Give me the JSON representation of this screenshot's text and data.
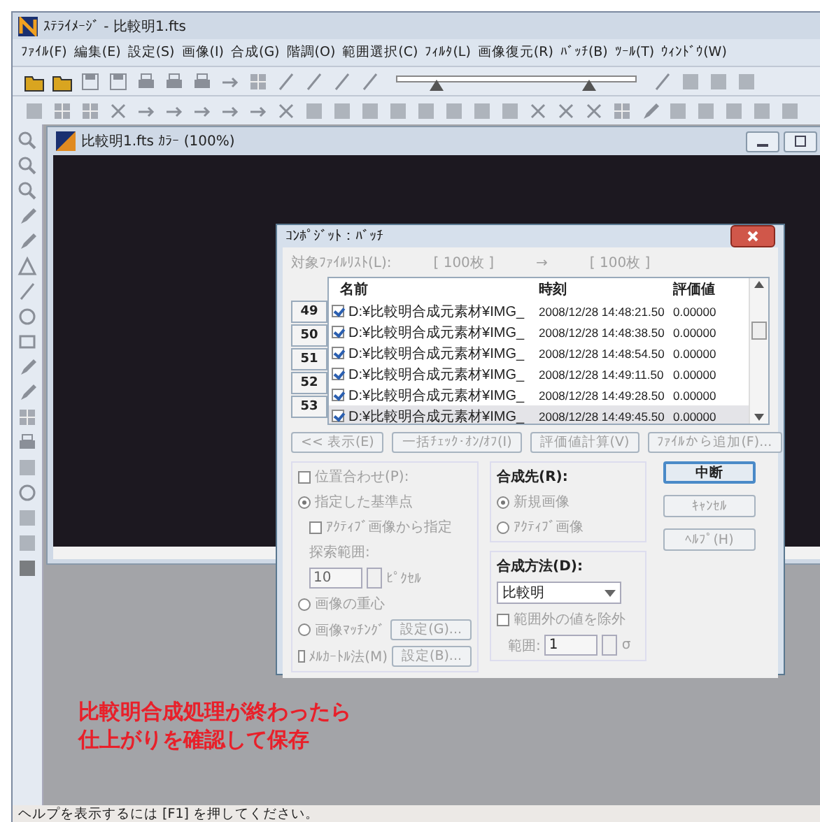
{
  "window": {
    "title": "ｽﾃﾗｲﾒｰｼﾞ - 比較明1.fts"
  },
  "menu": [
    "ﾌｧｲﾙ(F)",
    "編集(E)",
    "設定(S)",
    "画像(I)",
    "合成(G)",
    "階調(O)",
    "範囲選択(C)",
    "ﾌｨﾙﾀ(L)",
    "画像復元(R)",
    "ﾊﾞｯﾁ(B)",
    "ﾂｰﾙ(T)",
    "ｳｨﾝﾄﾞｳ(W)"
  ],
  "toolbar": {
    "slider_thumbs": [
      {
        "level": 0.17
      },
      {
        "level": 0.8
      }
    ]
  },
  "child_window": {
    "title": "比較明1.fts ｶﾗｰ (100%)"
  },
  "dialog": {
    "title": "ｺﾝﾎﾟｼﾞｯﾄ：ﾊﾞｯﾁ",
    "file_list_label": "対象ﾌｧｲﾙﾘｽﾄ(L):",
    "count_from": "[ 100枚 ]",
    "arrow": "→",
    "count_to": "[ 100枚 ]",
    "columns": [
      "名前",
      "時刻",
      "評価値"
    ],
    "rows": [
      {
        "number": "49",
        "checked": true,
        "selected": false,
        "name": "D:¥比較明合成元素材¥IMG_",
        "time": "2008/12/28 14:48:21.50",
        "value": "0.00000"
      },
      {
        "number": "50",
        "checked": true,
        "selected": false,
        "name": "D:¥比較明合成元素材¥IMG_",
        "time": "2008/12/28 14:48:38.50",
        "value": "0.00000"
      },
      {
        "number": "51",
        "checked": true,
        "selected": false,
        "name": "D:¥比較明合成元素材¥IMG_",
        "time": "2008/12/28 14:48:54.50",
        "value": "0.00000"
      },
      {
        "number": "52",
        "checked": true,
        "selected": false,
        "name": "D:¥比較明合成元素材¥IMG_",
        "time": "2008/12/28 14:49:11.50",
        "value": "0.00000"
      },
      {
        "number": "53",
        "checked": true,
        "selected": false,
        "name": "D:¥比較明合成元素材¥IMG_",
        "time": "2008/12/28 14:49:28.50",
        "value": "0.00000"
      },
      {
        "checked": true,
        "selected": true,
        "name": "D:¥比較明合成元素材¥IMG_",
        "time": "2008/12/28 14:49:45.50",
        "value": "0.00000"
      }
    ],
    "list_buttons": [
      {
        "label": "<< 表示(E)",
        "disabled": true
      },
      {
        "label": "一括ﾁｪｯｸ･ｵﾝ/ｵﾌ(I)",
        "disabled": true
      },
      {
        "label": "評価値計算(V)",
        "disabled": true
      },
      {
        "label": "ﾌｧｲﾙから追加(F)...",
        "disabled": true
      }
    ],
    "alignment": {
      "label": "位置合わせ(P):",
      "checked": false,
      "disabled": true,
      "options": [
        {
          "kind": "radio",
          "label": "指定した基準点",
          "selected": true,
          "disabled": true,
          "children": [
            {
              "kind": "checkbox",
              "label": "ｱｸﾃｨﾌﾞ画像から指定",
              "checked": false,
              "disabled": true
            },
            {
              "kind": "label",
              "label": "探索範囲:",
              "disabled": true
            },
            {
              "kind": "spin",
              "value": "10",
              "unit": "ﾋﾟｸｾﾙ",
              "disabled": true
            }
          ]
        },
        {
          "kind": "radio",
          "label": "画像の重心",
          "selected": false,
          "disabled": true
        },
        {
          "kind": "radio",
          "label": "画像ﾏｯﾁﾝｸﾞ",
          "selected": false,
          "disabled": true,
          "button": "設定(G)..."
        },
        {
          "kind": "checkbox",
          "label": "ﾒﾙｶｰﾄﾙ法(M)",
          "checked": false,
          "disabled": true,
          "button": "設定(B)..."
        }
      ]
    },
    "destination": {
      "label": "合成先(R):",
      "options": [
        {
          "label": "新規画像",
          "selected": true,
          "disabled": true
        },
        {
          "label": "ｱｸﾃｨﾌﾞ画像",
          "selected": false,
          "disabled": true
        }
      ]
    },
    "method": {
      "label": "合成方法(D):",
      "value": "比較明",
      "exclude": {
        "label": "範囲外の値を除外",
        "checked": false,
        "disabled": true
      },
      "range_label": "範囲:",
      "range_value": "1",
      "range_unit": "σ"
    },
    "buttons": [
      {
        "label": "中断",
        "default": true,
        "disabled": false
      },
      {
        "label": "ｷｬﾝｾﾙ",
        "default": false,
        "disabled": true
      },
      {
        "label": "ﾍﾙﾌﾟ(H)",
        "default": false,
        "disabled": true
      }
    ]
  },
  "annotation": [
    "比較明合成処理が終わったら",
    "仕上がりを確認して保存"
  ],
  "status_bar": "ヘルプを表示するには [F1] を押してください。"
}
